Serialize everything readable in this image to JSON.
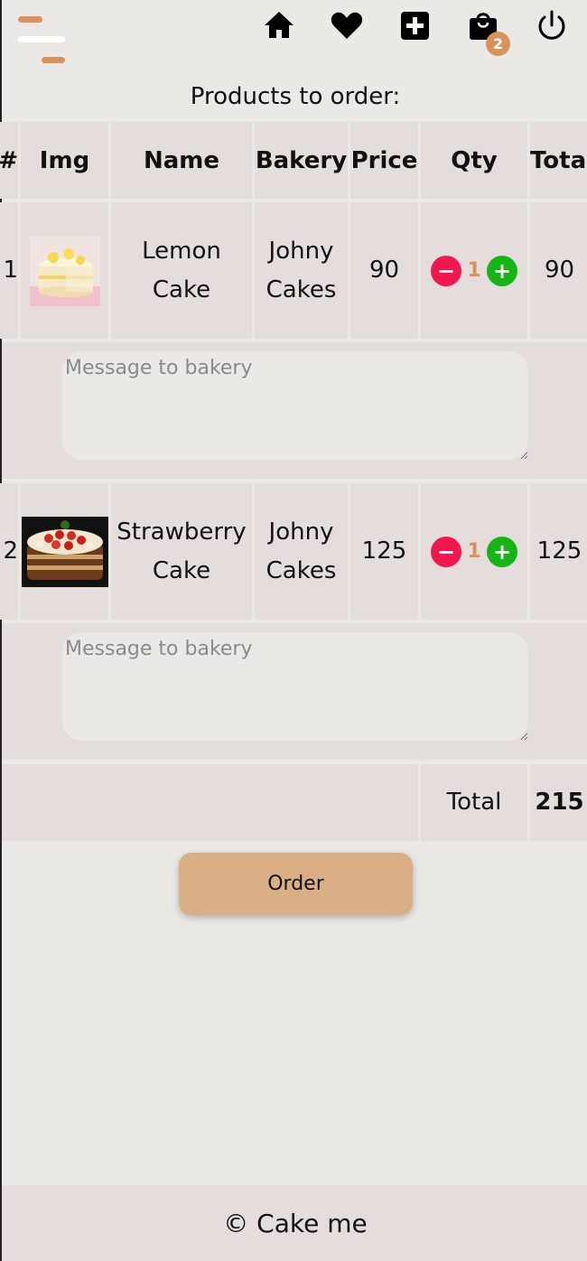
{
  "header": {
    "nav_icons": [
      "home-icon",
      "heart-icon",
      "add-square-icon",
      "shopping-bag-icon",
      "power-icon"
    ],
    "cart_count": "2"
  },
  "page_title": "Products to order:",
  "table": {
    "columns": [
      "#",
      "Img",
      "Name",
      "Bakery",
      "Price",
      "Qty",
      "Total"
    ],
    "rows": [
      {
        "index": "1",
        "name": "Lemon Cake",
        "bakery": "Johny Cakes",
        "price": "90",
        "qty": "1",
        "total": "90",
        "message_placeholder": "Message to bakery"
      },
      {
        "index": "2",
        "name": "Strawberry Cake",
        "bakery": "Johny Cakes",
        "price": "125",
        "qty": "1",
        "total": "125",
        "message_placeholder": "Message to bakery"
      }
    ],
    "summary": {
      "label": "Total",
      "value": "215"
    }
  },
  "order_button": "Order",
  "footer": "© Cake me",
  "colors": {
    "accent": "#d9925a",
    "minus": "#f2184e",
    "plus": "#14b514",
    "row": "#e5dcdc",
    "page": "#ebe9e6"
  }
}
